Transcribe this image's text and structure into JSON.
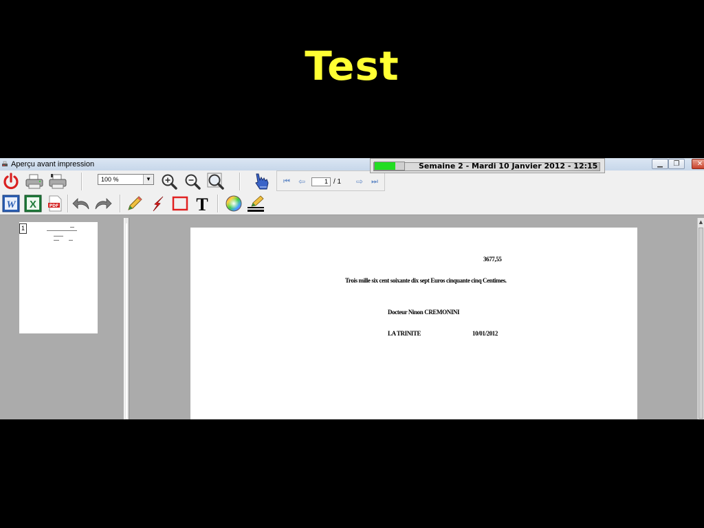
{
  "slide": {
    "title": "Test"
  },
  "window": {
    "title": "Aperçu avant impression",
    "colors": {
      "title_yellow": "#ffff33",
      "progress_green": "#22dd22",
      "power_red": "#d92020"
    }
  },
  "status": {
    "text": "Semaine 2 - Mardi 10 Janvier 2012 - 12:15",
    "progress_percent": 70
  },
  "toolbar": {
    "zoom_value": "100 %",
    "page_current": "1",
    "page_total": "/ 1"
  },
  "thumbnails": [
    {
      "number": "1"
    }
  ],
  "document": {
    "amount": "3677,55",
    "amount_words": "Trois mille six cent soixante dix sept Euros cinquante cinq Centimes.",
    "signatory": "Docteur Ninon CREMONINI",
    "place": "LA TRINITE",
    "date": "10/01/2012"
  }
}
